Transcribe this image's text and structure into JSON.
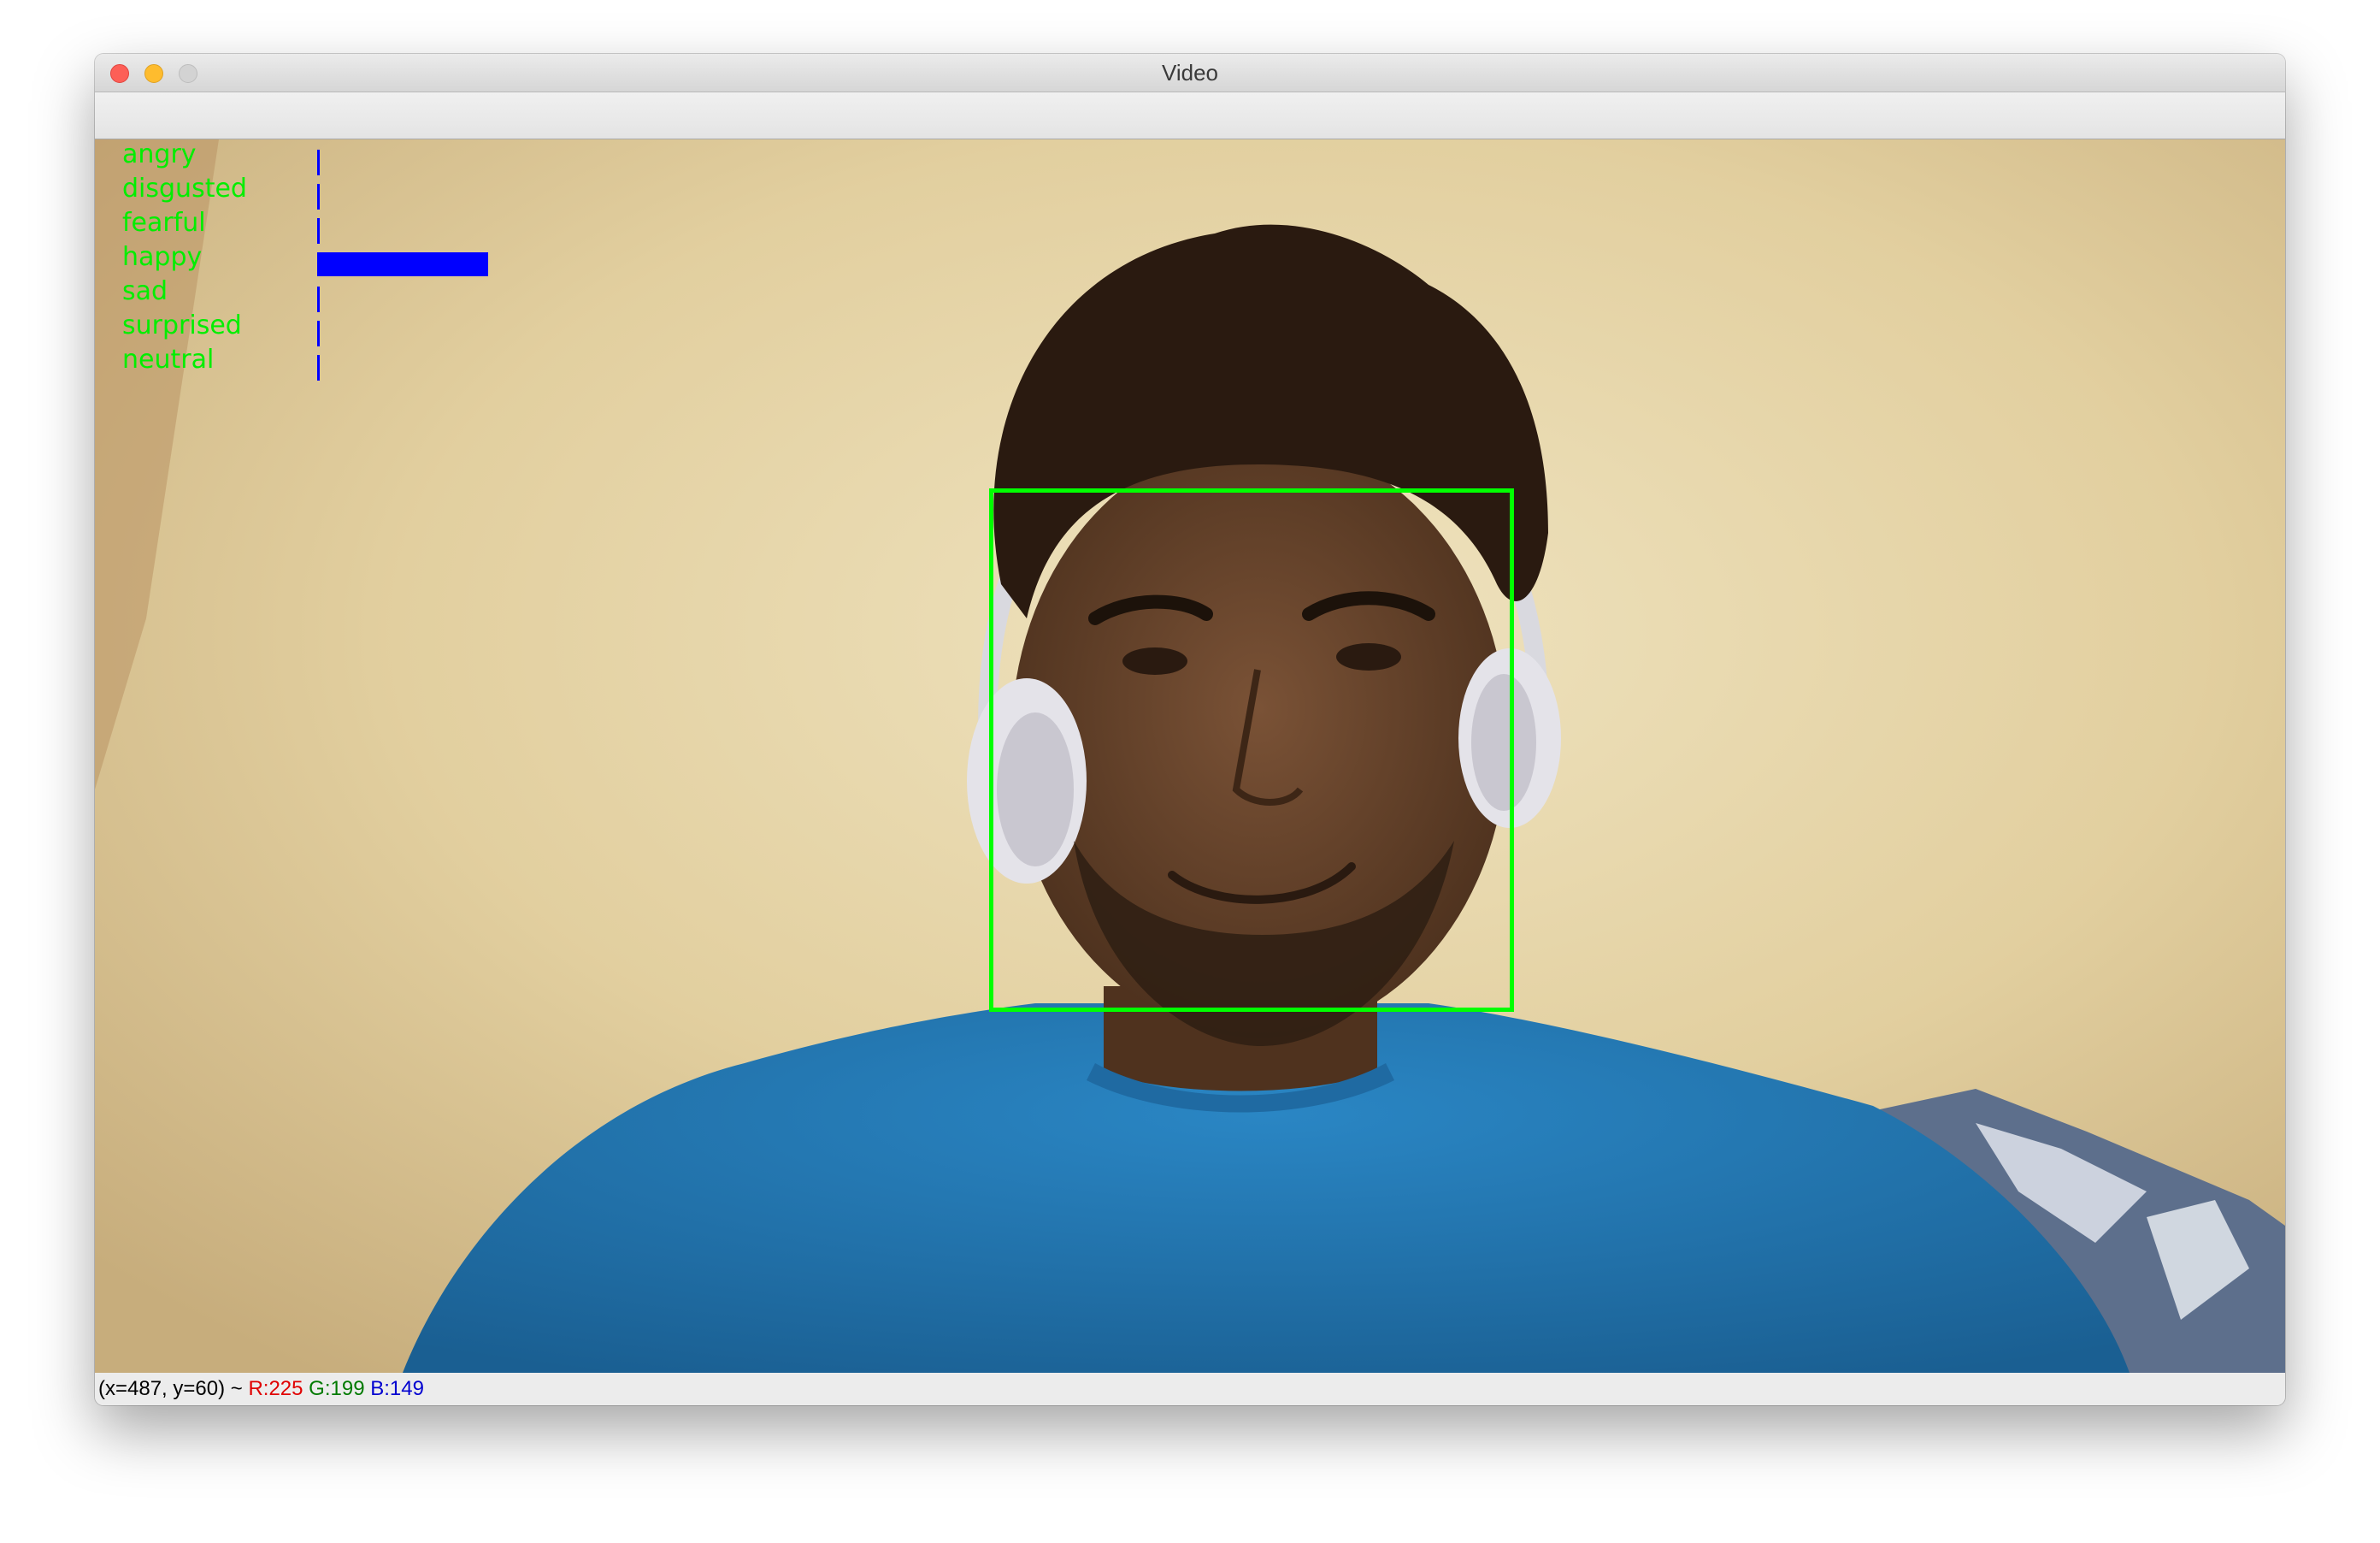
{
  "window": {
    "title": "Video"
  },
  "emotions": [
    {
      "label": "angry",
      "value": 0.0
    },
    {
      "label": "disgusted",
      "value": 0.0
    },
    {
      "label": "fearful",
      "value": 0.0
    },
    {
      "label": "happy",
      "value": 1.0
    },
    {
      "label": "sad",
      "value": 0.0
    },
    {
      "label": "surprised",
      "value": 0.0
    },
    {
      "label": "neutral",
      "value": 0.0
    }
  ],
  "status": {
    "coords": "(x=487, y=60) ~ ",
    "r": "R:225",
    "g": " G:199",
    "b": " B:149",
    "r_color": "#e00000",
    "g_color": "#007a00",
    "b_color": "#0000d0"
  },
  "colors": {
    "label_green": "#00ee00",
    "face_box": "#00ff00",
    "bar_blue": "#0000ff"
  }
}
